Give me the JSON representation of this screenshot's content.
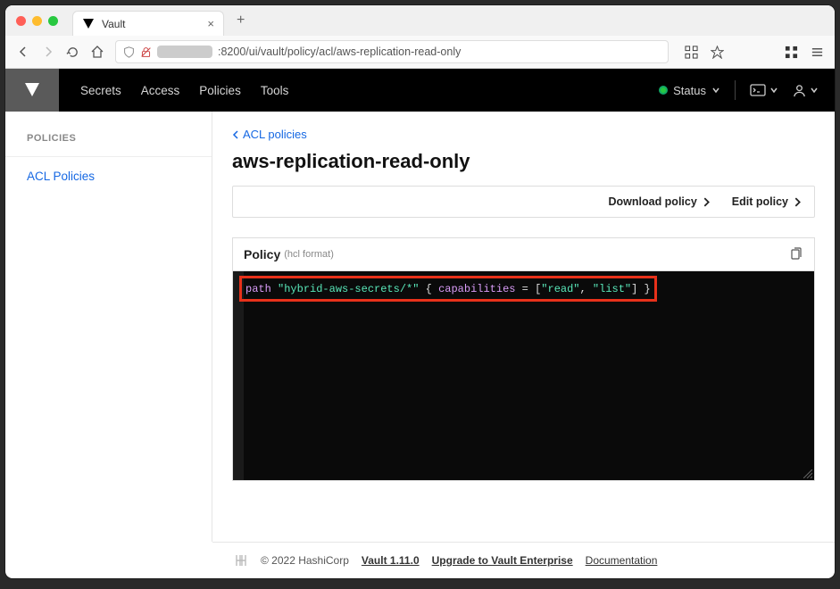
{
  "browser": {
    "tab_title": "Vault",
    "url_suffix": ":8200/ui/vault/policy/acl/aws-replication-read-only"
  },
  "nav": {
    "items": [
      "Secrets",
      "Access",
      "Policies",
      "Tools"
    ],
    "status_label": "Status"
  },
  "sidebar": {
    "heading": "POLICIES",
    "items": [
      {
        "label": "ACL Policies"
      }
    ]
  },
  "main": {
    "breadcrumb": "ACL policies",
    "title": "aws-replication-read-only",
    "actions": {
      "download": "Download policy",
      "edit": "Edit policy"
    },
    "panel_title": "Policy",
    "panel_sub": "(hcl format)",
    "code": {
      "keyword": "path",
      "path_str": "\"hybrid-aws-secrets/*\"",
      "open": " { ",
      "attr": "capabilities",
      "eq": " = [",
      "val1": "\"read\"",
      "comma": ", ",
      "val2": "\"list\"",
      "close": "] }"
    }
  },
  "footer": {
    "copyright": "© 2022 HashiCorp",
    "version": "Vault 1.11.0",
    "upgrade": "Upgrade to Vault Enterprise",
    "docs": "Documentation"
  }
}
